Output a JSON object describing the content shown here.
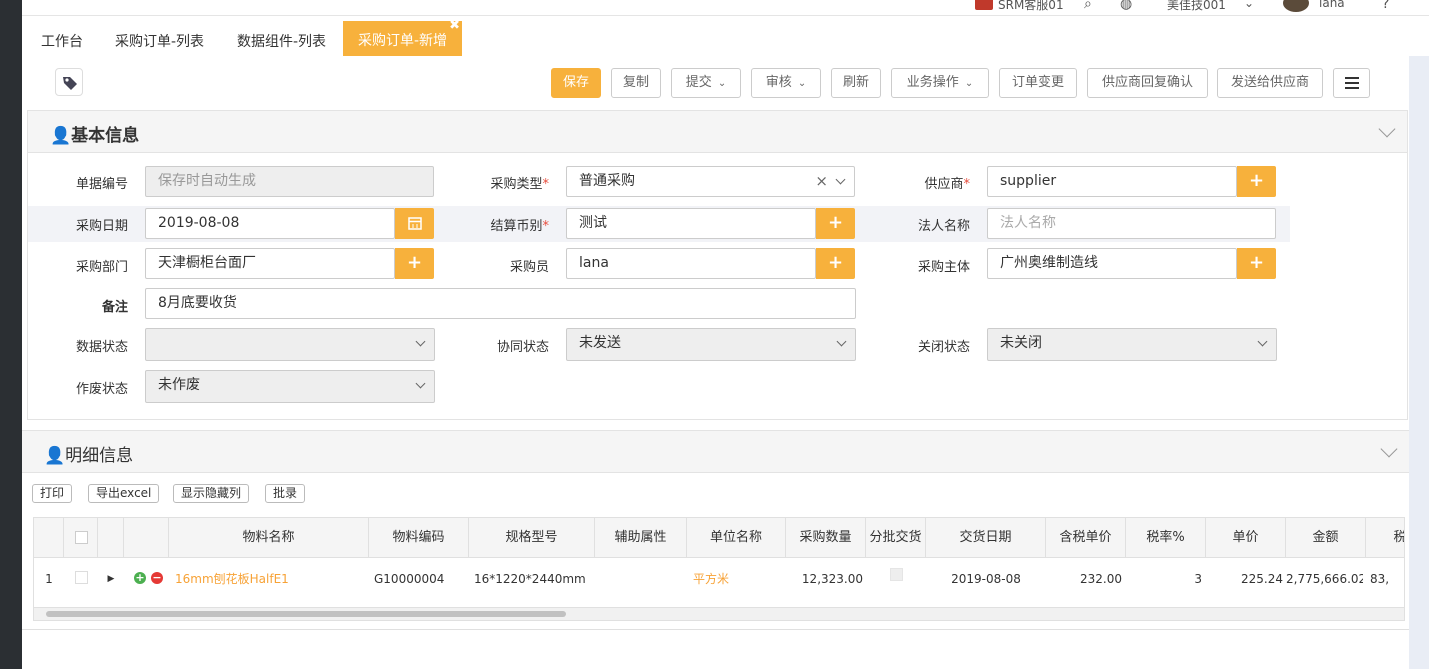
{
  "topbar": {
    "user_service": "SRM客服01",
    "org": "美佳技001",
    "user": "lana"
  },
  "tabs": [
    {
      "label": "工作台"
    },
    {
      "label": "采购订单-列表"
    },
    {
      "label": "数据组件-列表"
    },
    {
      "label": "采购订单-新增",
      "close": "✖"
    }
  ],
  "toolbar": {
    "save": "保存",
    "copy": "复制",
    "submit": "提交",
    "audit": "审核",
    "refresh": "刷新",
    "business_ops": "业务操作",
    "order_change": "订单变更",
    "supplier_confirm": "供应商回复确认",
    "send_supplier": "发送给供应商"
  },
  "basic": {
    "title": "基本信息",
    "doc_no": {
      "label": "单据编号",
      "value": "保存时自动生成"
    },
    "purchase_type": {
      "label": "采购类型",
      "value": "普通采购"
    },
    "supplier": {
      "label": "供应商",
      "value": "supplier"
    },
    "purchase_date": {
      "label": "采购日期",
      "value": "2019-08-08"
    },
    "currency": {
      "label": "结算币别",
      "value": "测试"
    },
    "legal_name": {
      "label": "法人名称",
      "placeholder": "法人名称"
    },
    "dept": {
      "label": "采购部门",
      "value": "天津橱柜台面厂"
    },
    "buyer": {
      "label": "采购员",
      "value": "lana"
    },
    "entity": {
      "label": "采购主体",
      "value": "广州奥维制造线"
    },
    "remark": {
      "label": "备注",
      "value": "8月底要收货"
    },
    "data_status": {
      "label": "数据状态",
      "value": ""
    },
    "collab_status": {
      "label": "协同状态",
      "value": "未发送"
    },
    "close_status": {
      "label": "关闭状态",
      "value": "未关闭"
    },
    "void_status": {
      "label": "作废状态",
      "value": "未作废"
    },
    "required_mark": "*",
    "plus": "+"
  },
  "detail": {
    "title": "明细信息",
    "buttons": {
      "print": "打印",
      "export": "导出excel",
      "show_hidden": "显示隐藏列",
      "batch": "批录"
    },
    "columns": [
      "物料名称",
      "物料编码",
      "规格型号",
      "辅助属性",
      "单位名称",
      "采购数量",
      "分批交货",
      "交货日期",
      "含税单价",
      "税率%",
      "单价",
      "金额",
      "税"
    ],
    "rows": [
      {
        "index": "1",
        "material_name": "16mm刨花板HalfE1",
        "material_code": "G10000004",
        "spec": "16*1220*2440mm",
        "aux": "",
        "unit": "平方米",
        "qty": "12,323.00",
        "delivery_date": "2019-08-08",
        "tax_price": "232.00",
        "tax_rate": "3",
        "price": "225.24",
        "amount": "2,775,666.02",
        "tax": "83,"
      }
    ]
  },
  "colors": {
    "accent": "#f7b13c",
    "link_orange": "#f7a236"
  }
}
